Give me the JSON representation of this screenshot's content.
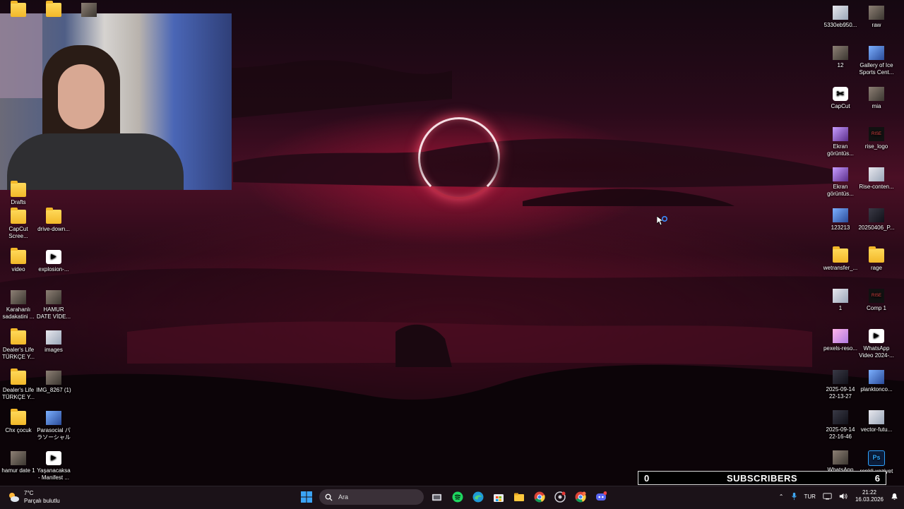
{
  "desktop": {
    "left_icons": [
      {
        "label": "",
        "type": "folder"
      },
      {
        "label": "",
        "type": "folder"
      },
      {
        "label": "",
        "type": "thumb"
      },
      {
        "label": "Drafts",
        "type": "folder"
      },
      {
        "label": "CapCut Scree...",
        "type": "folder"
      },
      {
        "label": "drive-down...",
        "type": "folder"
      },
      {
        "label": "video",
        "type": "folder"
      },
      {
        "label": "explosion-...",
        "type": "video"
      },
      {
        "label": "Karahanlı sadakatini ...",
        "type": "thumb"
      },
      {
        "label": "HAMUR DATE VİDE...",
        "type": "thumb"
      },
      {
        "label": "Dealer's Life TÜRKÇE Y...",
        "type": "folder"
      },
      {
        "label": "images",
        "type": "thumb-light"
      },
      {
        "label": "Dealer's Life TÜRKÇE Y...",
        "type": "folder"
      },
      {
        "label": "IMG_8267 (1)",
        "type": "thumb"
      },
      {
        "label": "Chx çocuk",
        "type": "folder"
      },
      {
        "label": "Parasocial パラソーシャル",
        "type": "thumb-blue"
      },
      {
        "label": "hamur date 1",
        "type": "thumb"
      },
      {
        "label": "Yaşanacaksa - Manifest ...",
        "type": "video"
      }
    ],
    "right_icons": [
      {
        "label": "5330eb950...",
        "type": "thumb-light"
      },
      {
        "label": "raw",
        "type": "thumb"
      },
      {
        "label": "12",
        "type": "thumb"
      },
      {
        "label": "Gallery of Ice Sports Cent...",
        "type": "thumb-blue"
      },
      {
        "label": "CapCut",
        "type": "capcut"
      },
      {
        "label": "mia",
        "type": "thumb"
      },
      {
        "label": "Ekran görüntüs...",
        "type": "thumb-purple"
      },
      {
        "label": "rise_logo",
        "type": "rise"
      },
      {
        "label": "Ekran görüntüs...",
        "type": "thumb-purple"
      },
      {
        "label": "Rise-conten...",
        "type": "thumb-light"
      },
      {
        "label": "123213",
        "type": "thumb-blue"
      },
      {
        "label": "20250406_P...",
        "type": "thumb-dark"
      },
      {
        "label": "wetransfer_...",
        "type": "folder"
      },
      {
        "label": "rage",
        "type": "folder"
      },
      {
        "label": "1",
        "type": "thumb-light"
      },
      {
        "label": "Comp 1",
        "type": "rise"
      },
      {
        "label": "pexels-reso...",
        "type": "thumb-pink"
      },
      {
        "label": "WhatsApp Video 2024-...",
        "type": "video"
      },
      {
        "label": "2025-09-14 22-13-27",
        "type": "thumb-dark"
      },
      {
        "label": "planktonco...",
        "type": "thumb-blue"
      },
      {
        "label": "2025-09-14 22-16-46",
        "type": "thumb-dark"
      },
      {
        "label": "vector-futu...",
        "type": "thumb-light"
      },
      {
        "label": "WhatsApp Görsel 2025...",
        "type": "thumb"
      },
      {
        "label": "renkli-vaziyet",
        "type": "ps"
      }
    ]
  },
  "overlay": {
    "subscriber_count_left": "0",
    "subscriber_label": "SUBSCRIBERS",
    "subscriber_count_right": "6"
  },
  "taskbar": {
    "weather_temp": "7°C",
    "weather_desc": "Parçalı bulutlu",
    "search_placeholder": "Ara",
    "apps": [
      "start-icon",
      "task-view-icon",
      "spotify-icon",
      "edge-icon",
      "store-icon",
      "file-explorer-icon",
      "chrome-icon",
      "chrome-profile-icon",
      "chrome-profile-2-icon",
      "discord-icon"
    ],
    "language": "TUR",
    "time": "21:22",
    "date": "16.03.2026"
  },
  "colors": {
    "accent_ring": "#ffe6ec",
    "sky_red": "#4a0f25",
    "taskbar_bg": "#1c141a"
  }
}
